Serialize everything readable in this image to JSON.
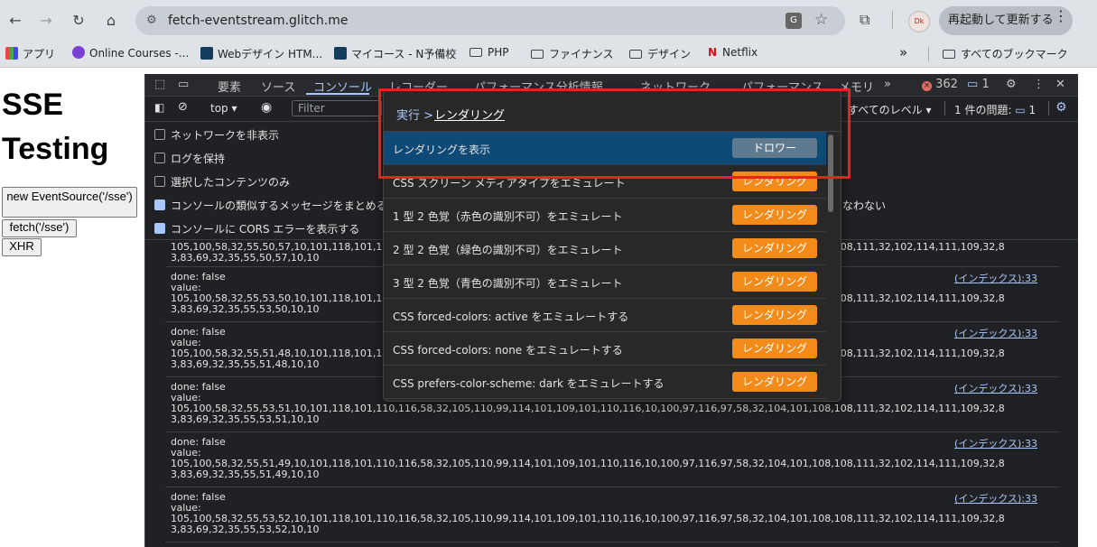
{
  "browser": {
    "url": "fetch-eventstream.glitch.me",
    "relaunch_label": "再起動して更新する",
    "avatar_text": "Dk"
  },
  "bookmarks": {
    "apps": "アプリ",
    "items": [
      "Online Courses -...",
      "Webデザイン HTM...",
      "マイコース - N予備校",
      "PHP",
      "ファイナンス",
      "デザイン",
      "Netflix"
    ],
    "overflow": "»",
    "all": "すべてのブックマーク"
  },
  "page": {
    "title": "SSE Testing",
    "buttons": [
      "new EventSource('/sse')",
      "fetch('/sse')",
      "XHR"
    ]
  },
  "devtools": {
    "tabs": [
      "要素",
      "ソース",
      "コンソール",
      "レコーダー",
      "パフォーマンス分析情報",
      "ネットワーク",
      "パフォーマンス",
      "メモリ"
    ],
    "error_count": "362",
    "msg_count": "1",
    "toolbar": {
      "context": "top",
      "filter_placeholder": "Filter",
      "levels": "すべてのレベル",
      "issues": "1 件の問題:",
      "issues_count": "1"
    },
    "options": [
      {
        "label": "ネットワークを非表示",
        "checked": false
      },
      {
        "label": "ログを保持",
        "checked": false
      },
      {
        "label": "選択したコンテンツのみ",
        "checked": false
      },
      {
        "label": "コンソールの類似するメッセージをまとめる",
        "checked": true
      },
      {
        "label": "コンソールに CORS エラーを表示する",
        "checked": true
      }
    ],
    "right_option_fragment": "なわない",
    "logs": {
      "first_line": "105,100,58,32,55,50,57,10,101,118,101,110,116,58,32,105,110,99,114,101,109,101,110,116,10,100,97,116,97,58,32,104,101,108,108,111,32,102,114,111,109,32,8",
      "first_line2": "3,83,69,32,35,55,50,57,10,10",
      "entries": [
        {
          "done": "done: false",
          "value": "value:",
          "line1": "105,100,58,32,55,53,50,10,101,118,101,110,116,58,32,105,110,99,114,101,109,101,110,116,10,100,97,116,97,58,32,104,101,108,108,111,32,102,114,111,109,32,8",
          "line2": "3,83,69,32,35,55,53,50,10,10",
          "src": "(インデックス):33"
        },
        {
          "done": "done: false",
          "value": "value:",
          "line1": "105,100,58,32,55,51,48,10,101,118,101,110,116,58,32,105,110,99,114,101,109,101,110,116,10,100,97,116,97,58,32,104,101,108,108,111,32,102,114,111,109,32,8",
          "line2": "3,83,69,32,35,55,51,48,10,10",
          "src": "(インデックス):33"
        },
        {
          "done": "done: false",
          "value": "value:",
          "line1": "105,100,58,32,55,53,51,10,101,118,101,110,116,58,32,105,110,99,114,101,109,101,110,116,10,100,97,116,97,58,32,104,101,108,108,111,32,102,114,111,109,32,8",
          "line2": "3,83,69,32,35,55,53,51,10,10",
          "src": "(インデックス):33"
        },
        {
          "done": "done: false",
          "value": "value:",
          "line1": "105,100,58,32,55,51,49,10,101,118,101,110,116,58,32,105,110,99,114,101,109,101,110,116,10,100,97,116,97,58,32,104,101,108,108,111,32,102,114,111,109,32,8",
          "line2": "3,83,69,32,35,55,51,49,10,10",
          "src": "(インデックス):33"
        },
        {
          "done": "done: false",
          "value": "value:",
          "line1": "105,100,58,32,55,53,52,10,101,118,101,110,116,58,32,105,110,99,114,101,109,101,110,116,10,100,97,116,97,58,32,104,101,108,108,111,32,102,114,111,109,32,8",
          "line2": "3,83,69,32,35,55,53,52,10,10",
          "src": "(インデックス):33"
        }
      ]
    }
  },
  "command_menu": {
    "prompt": "実行 >",
    "query": "レンダリング",
    "rows": [
      {
        "label": "レンダリングを表示",
        "tag": "ドロワー"
      },
      {
        "label": "CSS スクリーン メディアタイプをエミュレート",
        "tag": "レンダリング"
      },
      {
        "label": "1 型 2 色覚（赤色の識別不可）をエミュレート",
        "tag": "レンダリング"
      },
      {
        "label": "2 型 2 色覚（緑色の識別不可）をエミュレート",
        "tag": "レンダリング"
      },
      {
        "label": "3 型 2 色覚（青色の識別不可）をエミュレート",
        "tag": "レンダリング"
      },
      {
        "label": "CSS forced-colors: active をエミュレートする",
        "tag": "レンダリング"
      },
      {
        "label": "CSS forced-colors: none をエミュレートする",
        "tag": "レンダリング"
      },
      {
        "label": "CSS prefers-color-scheme: dark をエミュレートする",
        "tag": "レンダリング"
      }
    ]
  },
  "colors": {
    "accent": "#a8c7fa",
    "tag_orange": "#f28b1a",
    "highlight": "#e8231c",
    "selected": "#0e4a75"
  }
}
